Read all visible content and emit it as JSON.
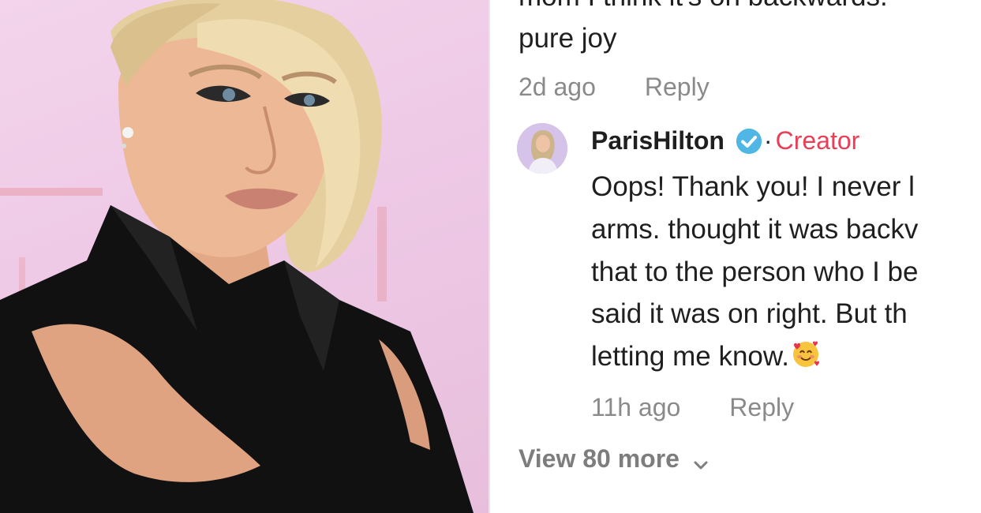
{
  "photo": {
    "description_icon": "portrait-photo"
  },
  "comments": {
    "cut_line": "mom I think it's on backwards.",
    "first_comment_last_line": "pure joy",
    "first_meta": {
      "time": "2d ago",
      "reply_label": "Reply"
    },
    "reply": {
      "username": "ParisHilton",
      "verified_icon": "verified-badge-icon",
      "separator": "·",
      "badge": "Creator",
      "badge_color": "#ea3d56",
      "lines": [
        "Oops! Thank you! I never l",
        "arms. thought it was backv",
        "that to the person who I be",
        "said it was on right. But th",
        "letting me know."
      ],
      "emoji_icon": "smiling-face-with-hearts-icon",
      "time": "11h ago",
      "reply_label": "Reply"
    },
    "view_more": "View 80 more",
    "view_more_icon": "chevron-down-icon"
  }
}
